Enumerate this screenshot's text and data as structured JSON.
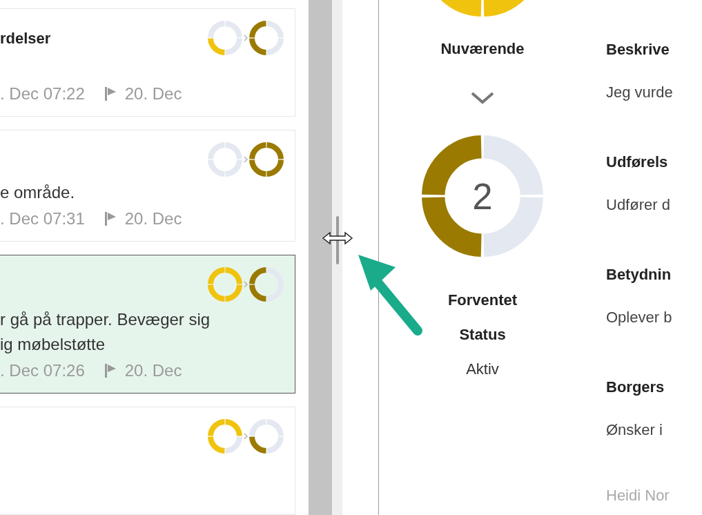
{
  "cards": [
    {
      "title": "rdelser",
      "created": ". Dec 07:22",
      "deadline": "20. Dec",
      "selected": false,
      "current_segments": [
        {
          "filled": true
        },
        {
          "filled": false
        },
        {
          "filled": false
        },
        {
          "filled": false
        }
      ],
      "expected_segments": [
        {
          "filled": true
        },
        {
          "filled": true
        },
        {
          "filled": false
        },
        {
          "filled": false
        }
      ]
    },
    {
      "lines": [
        "e område."
      ],
      "created": ". Dec 07:31",
      "deadline": "20. Dec",
      "selected": false,
      "current_segments": [
        {
          "filled": false
        },
        {
          "filled": false
        },
        {
          "filled": false
        },
        {
          "filled": false
        }
      ],
      "expected_segments": [
        {
          "filled": true
        },
        {
          "filled": true
        },
        {
          "filled": true
        },
        {
          "filled": true
        }
      ]
    },
    {
      "lines": [
        "r gå på trapper. Bevæger sig",
        "ig møbelstøtte"
      ],
      "created": ". Dec 07:26",
      "deadline": "20. Dec",
      "selected": true,
      "current_segments": [
        {
          "filled": true
        },
        {
          "filled": true
        },
        {
          "filled": true
        },
        {
          "filled": true
        }
      ],
      "expected_segments": [
        {
          "filled": true
        },
        {
          "filled": true
        },
        {
          "filled": false
        },
        {
          "filled": false
        }
      ]
    },
    {
      "selected": false,
      "current_segments": [
        {
          "filled": true
        },
        {
          "filled": true
        },
        {
          "filled": true
        },
        {
          "filled": false
        }
      ],
      "expected_segments": [
        {
          "filled": true
        },
        {
          "filled": false
        },
        {
          "filled": false
        },
        {
          "filled": false
        }
      ]
    }
  ],
  "status": {
    "current_segments": [
      {
        "filled": true
      },
      {
        "filled": true
      }
    ],
    "current_label": "Nuværende",
    "expected": {
      "segments": [
        {
          "filled": true
        },
        {
          "filled": true
        },
        {
          "filled": false
        },
        {
          "filled": false
        }
      ],
      "value": "2",
      "label_lines": [
        "Forventet",
        "Status"
      ],
      "state": "Aktiv"
    }
  },
  "details": [
    {
      "heading": "Beskrive",
      "text": "Jeg vurde"
    },
    {
      "heading": "Udførels",
      "text": "Udfører d"
    },
    {
      "heading": "Betydnin",
      "text": "Oplever b"
    },
    {
      "heading": "Borgers",
      "text": "Ønsker i"
    }
  ],
  "author": "Heidi Nor"
}
